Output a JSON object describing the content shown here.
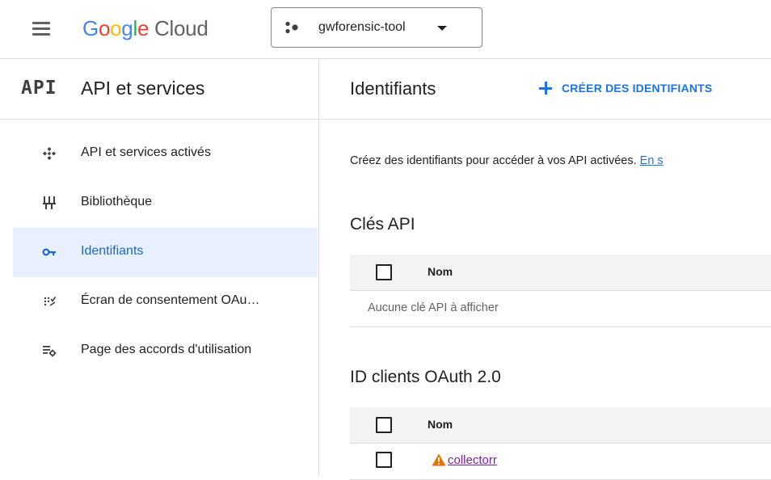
{
  "header": {
    "logo": {
      "letters": [
        "G",
        "o",
        "o",
        "g",
        "l",
        "e"
      ],
      "product": "Cloud"
    },
    "project_name": "gwforensic-tool"
  },
  "sidebar": {
    "api_mark": "API",
    "title": "API et services",
    "items": [
      {
        "label": "API et services activés",
        "icon": "api-services-icon",
        "active": false
      },
      {
        "label": "Bibliothèque",
        "icon": "library-icon",
        "active": false
      },
      {
        "label": "Identifiants",
        "icon": "key-icon",
        "active": true
      },
      {
        "label": "Écran de consentement OAu…",
        "icon": "consent-screen-icon",
        "active": false
      },
      {
        "label": "Page des accords d'utilisation",
        "icon": "agreements-icon",
        "active": false
      }
    ]
  },
  "main": {
    "title": "Identifiants",
    "create_button_label": "CRÉER DES IDENTIFIANTS",
    "intro_text": "Créez des identifiants pour accéder à vos API activées.",
    "intro_link": "En s",
    "api_keys": {
      "title": "Clés API",
      "column_name": "Nom",
      "empty_message": "Aucune clé API à afficher"
    },
    "oauth_clients": {
      "title": "ID clients OAuth 2.0",
      "column_name": "Nom",
      "rows": [
        {
          "name": "collectorr",
          "status": "warning"
        }
      ]
    }
  },
  "colors": {
    "accent": "#1a73e8",
    "active_bg": "#e8f0fe",
    "active_text": "#1967d2",
    "warning": "#e37400",
    "visited_link": "#7b1fa2",
    "divider": "#dadce0",
    "table_header_bg": "#f1f3f4"
  }
}
